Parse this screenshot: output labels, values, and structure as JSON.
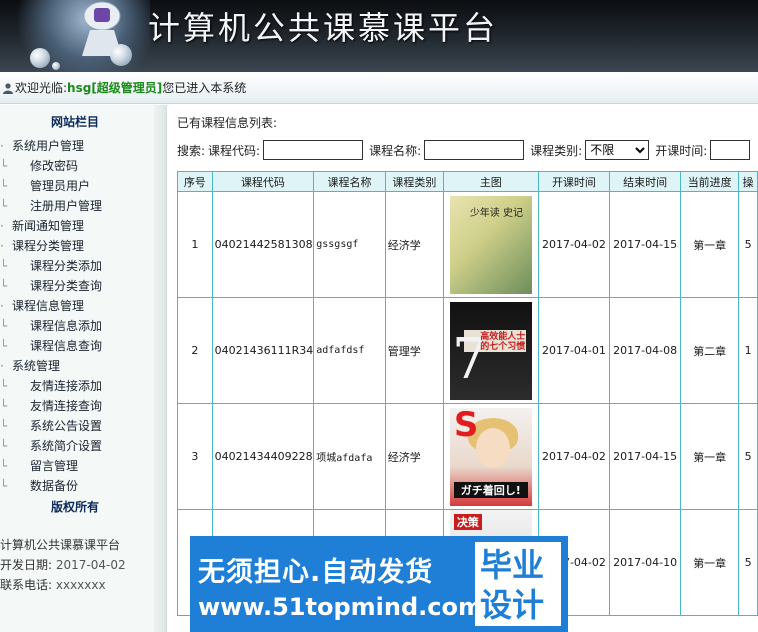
{
  "header": {
    "site_title": "计算机公共课慕课平台"
  },
  "welcome": {
    "prefix": "欢迎光临:",
    "username": "hsg[超级管理员]",
    "suffix": " 您已进入本系统"
  },
  "sidebar": {
    "title": "网站栏目",
    "items": [
      {
        "label": "系统用户管理",
        "level": 0
      },
      {
        "label": "修改密码",
        "level": 1
      },
      {
        "label": "管理员用户",
        "level": 1
      },
      {
        "label": "注册用户管理",
        "level": 1
      },
      {
        "label": "新闻通知管理",
        "level": 0
      },
      {
        "label": "课程分类管理",
        "level": 0
      },
      {
        "label": "课程分类添加",
        "level": 1
      },
      {
        "label": "课程分类查询",
        "level": 1
      },
      {
        "label": "课程信息管理",
        "level": 0
      },
      {
        "label": "课程信息添加",
        "level": 1
      },
      {
        "label": "课程信息查询",
        "level": 1
      },
      {
        "label": "系统管理",
        "level": 0
      },
      {
        "label": "友情连接添加",
        "level": 1
      },
      {
        "label": "友情连接查询",
        "level": 1
      },
      {
        "label": "系统公告设置",
        "level": 1
      },
      {
        "label": "系统简介设置",
        "level": 1
      },
      {
        "label": "留言管理",
        "level": 1
      },
      {
        "label": "数据备份",
        "level": 1
      }
    ],
    "copyright_title": "版权所有",
    "footer": [
      {
        "label": "计算机公共课慕课平台",
        "value": ""
      },
      {
        "label": "开发日期:",
        "value": "2017-04-02"
      },
      {
        "label": "联系电话:",
        "value": "xxxxxxx"
      }
    ]
  },
  "main": {
    "list_title": "已有课程信息列表:",
    "search": {
      "prefix": "搜索:",
      "code_label": "课程代码:",
      "code_value": "",
      "name_label": "课程名称:",
      "name_value": "",
      "type_label": "课程类别:",
      "type_selected": "不限",
      "time_label": "开课时间:"
    },
    "table": {
      "headers": [
        "序号",
        "课程代码",
        "课程名称",
        "课程类别",
        "主图",
        "开课时间",
        "结束时间",
        "当前进度",
        "操"
      ],
      "rows": [
        {
          "no": "1",
          "code": "04021442581308",
          "name": "gssgsgf",
          "type": "经济学",
          "cover_text": "少年读 史记",
          "start": "2017-04-02",
          "end": "2017-04-15",
          "progress": "第一章",
          "extra": "5"
        },
        {
          "no": "2",
          "code": "04021436111R34",
          "name": "adfafdsf",
          "type": "管理学",
          "cover_text": "高效能人士的七个习惯",
          "start": "2017-04-01",
          "end": "2017-04-08",
          "progress": "第二章",
          "extra": "1"
        },
        {
          "no": "3",
          "code": "04021434409228",
          "name": "项城afdafa",
          "type": "经济学",
          "cover_text": "ガチ着回し!",
          "start": "2017-04-02",
          "end": "2017-04-15",
          "progress": "第一章",
          "extra": "5"
        },
        {
          "no": "",
          "code": "",
          "name": "",
          "type": "",
          "cover_text": "决策",
          "start": "2017-04-02",
          "end": "2017-04-10",
          "progress": "第一章",
          "extra": "5"
        }
      ]
    }
  },
  "watermark": {
    "line1": "无须担心.自动发货",
    "line2": "www.51topmind.com",
    "badge_top": "毕业",
    "badge_bottom": "设计"
  }
}
